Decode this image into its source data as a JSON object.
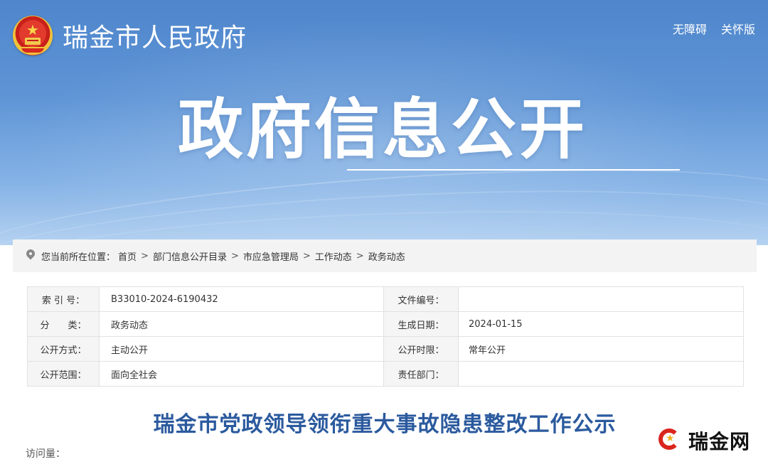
{
  "header": {
    "site_title": "瑞金市人民政府",
    "links": [
      "无障碍",
      "关怀版"
    ]
  },
  "hero": {
    "title": "政府信息公开"
  },
  "breadcrumb": {
    "label": "您当前所在位置：",
    "items": [
      "首页",
      "部门信息公开目录",
      "市应急管理局",
      "工作动态",
      "政务动态"
    ],
    "separator": ">"
  },
  "meta": {
    "rows": [
      {
        "label": "索 引 号：",
        "value": "B33010-2024-6190432",
        "label2": "文件编号：",
        "value2": ""
      },
      {
        "label": "分　　类：",
        "value": "政务动态",
        "label2": "生成日期：",
        "value2": "2024-01-15"
      },
      {
        "label": "公开方式：",
        "value": "主动公开",
        "label2": "公开时限：",
        "value2": "常年公开"
      },
      {
        "label": "公开范围：",
        "value": "面向全社会",
        "label2": "责任部门：",
        "value2": ""
      }
    ]
  },
  "article": {
    "title": "瑞金市党政领导领衔重大事故隐患整改工作公示",
    "visits_label": "访问量："
  },
  "watermark": {
    "text": "瑞金网"
  },
  "colors": {
    "banner_top": "#4f86cc",
    "banner_bottom": "#b5d2f1",
    "article_title": "#2b5a9e",
    "watermark_red": "#d9251d"
  }
}
